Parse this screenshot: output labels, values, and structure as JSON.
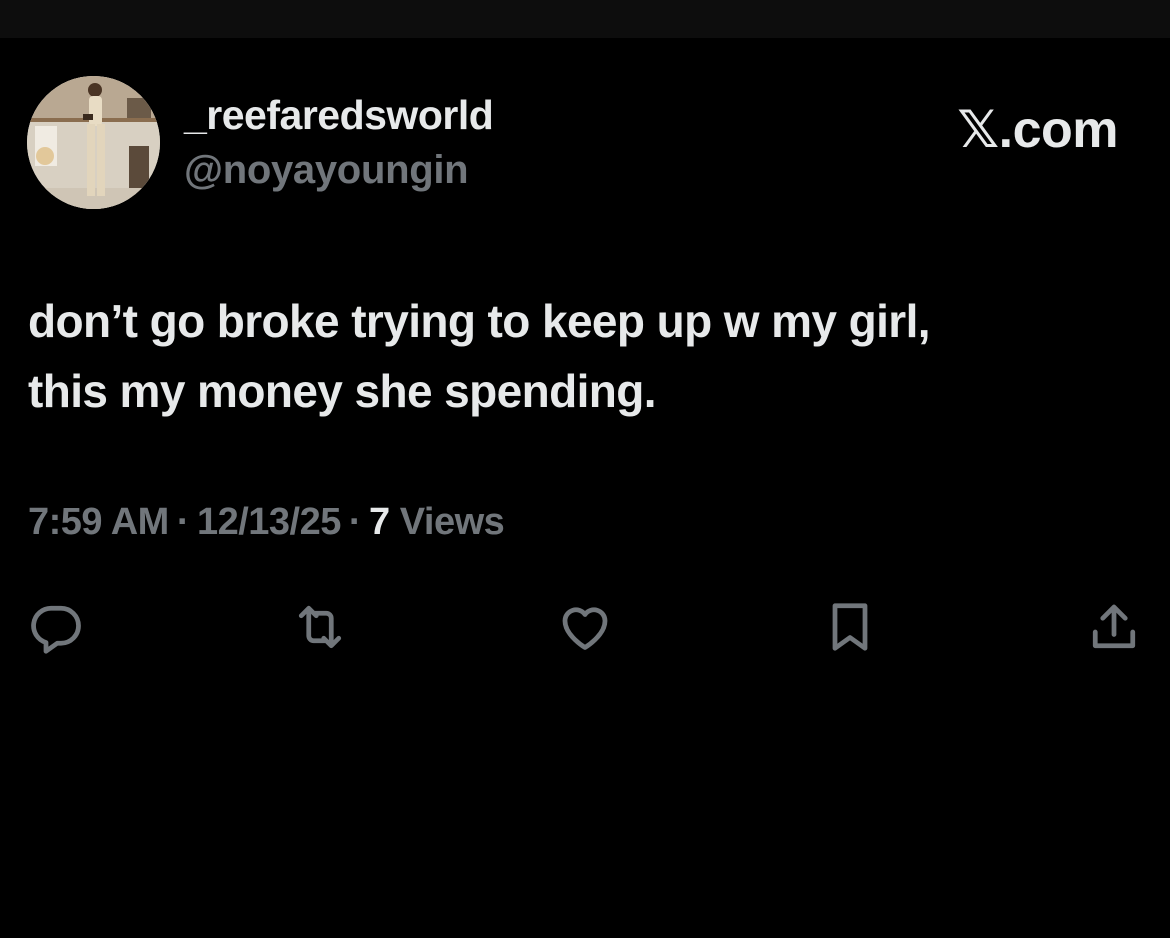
{
  "author": {
    "display_name": "_reefaredsworld",
    "handle": "@noyayoungin",
    "avatar": "avatar-photo"
  },
  "brand": {
    "x_glyph": "𝕏",
    "suffix": ".com"
  },
  "tweet": {
    "lines": [
      "don’t go broke trying to keep up w my girl,",
      "this my money she spending."
    ],
    "time": "7:59 AM",
    "date": "12/13/25",
    "separator": "·",
    "views_count": "7",
    "views_label": "Views"
  },
  "actions": [
    {
      "name": "reply",
      "icon": "reply-icon"
    },
    {
      "name": "repost",
      "icon": "repost-icon"
    },
    {
      "name": "like",
      "icon": "heart-icon"
    },
    {
      "name": "bookmark",
      "icon": "bookmark-icon"
    },
    {
      "name": "share",
      "icon": "share-icon"
    }
  ],
  "colors": {
    "background": "#000000",
    "primary_text": "#e7e9ea",
    "secondary_text": "#71767b"
  }
}
